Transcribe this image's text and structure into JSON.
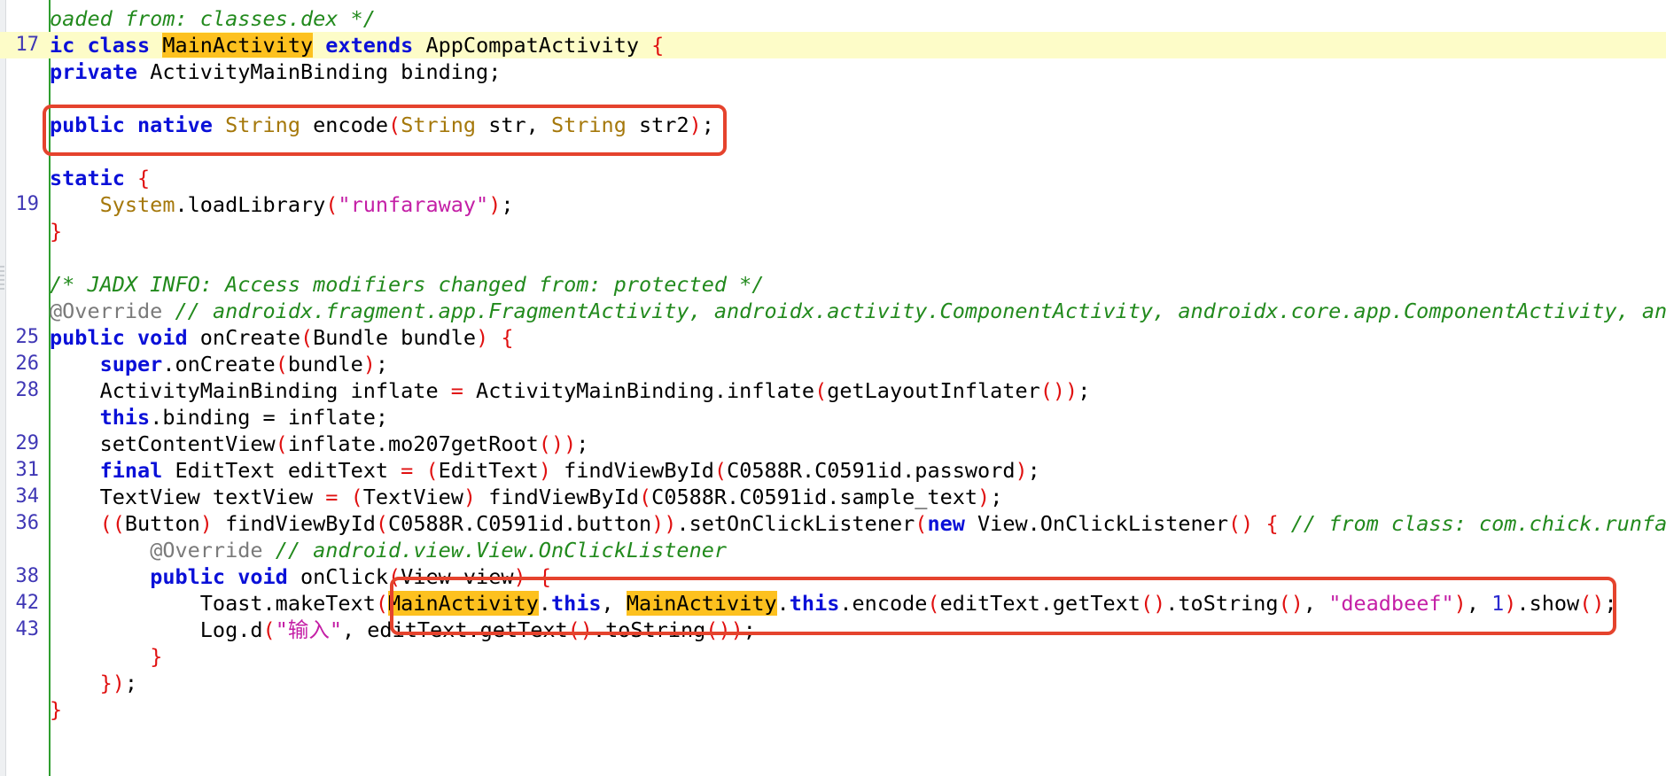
{
  "editor": {
    "lines": [
      {
        "no": "",
        "tokens": [
          [
            "cm",
            "oaded from: classes.dex */"
          ]
        ]
      },
      {
        "no": "17",
        "current": true,
        "tokens": [
          [
            "kw",
            "ic class "
          ],
          [
            "hl",
            "MainActivity"
          ],
          [
            "pl",
            " "
          ],
          [
            "kw",
            "extends"
          ],
          [
            "pl",
            " AppCompatActivity "
          ],
          [
            "pn",
            "{"
          ]
        ]
      },
      {
        "no": "",
        "tokens": [
          [
            "kw",
            "private"
          ],
          [
            "pl",
            " ActivityMainBinding binding;"
          ]
        ]
      },
      {
        "no": "",
        "tokens": []
      },
      {
        "no": "",
        "tokens": [
          [
            "kw",
            "public native"
          ],
          [
            "pl",
            " "
          ],
          [
            "ty",
            "String"
          ],
          [
            "pl",
            " encode"
          ],
          [
            "pn",
            "("
          ],
          [
            "ty",
            "String"
          ],
          [
            "pl",
            " str, "
          ],
          [
            "ty",
            "String"
          ],
          [
            "pl",
            " str2"
          ],
          [
            "pn",
            ")"
          ],
          [
            "pl",
            ";"
          ]
        ]
      },
      {
        "no": "",
        "tokens": []
      },
      {
        "no": "",
        "tokens": [
          [
            "kw",
            "static"
          ],
          [
            "pl",
            " "
          ],
          [
            "pn",
            "{"
          ]
        ]
      },
      {
        "no": "19",
        "tokens": [
          [
            "pl",
            "    "
          ],
          [
            "ty",
            "System"
          ],
          [
            "pl",
            ".loadLibrary"
          ],
          [
            "pn",
            "("
          ],
          [
            "st",
            "\"runfaraway\""
          ],
          [
            "pn",
            ")"
          ],
          [
            "pl",
            ";"
          ]
        ]
      },
      {
        "no": "",
        "tokens": [
          [
            "pn",
            "}"
          ]
        ]
      },
      {
        "no": "",
        "tokens": []
      },
      {
        "no": "",
        "tokens": [
          [
            "cm",
            "/* JADX INFO: Access modifiers changed from: protected */"
          ]
        ]
      },
      {
        "no": "",
        "tokens": [
          [
            "an",
            "@Override"
          ],
          [
            "pl",
            " "
          ],
          [
            "cm",
            "// androidx.fragment.app.FragmentActivity, androidx.activity.ComponentActivity, androidx.core.app.ComponentActivity, andr"
          ]
        ]
      },
      {
        "no": "25",
        "tokens": [
          [
            "kw",
            "public void"
          ],
          [
            "pl",
            " onCreate"
          ],
          [
            "pn",
            "("
          ],
          [
            "pl",
            "Bundle bundle"
          ],
          [
            "pn",
            ")"
          ],
          [
            "pl",
            " "
          ],
          [
            "pn",
            "{"
          ]
        ]
      },
      {
        "no": "26",
        "tokens": [
          [
            "pl",
            "    "
          ],
          [
            "kw",
            "super"
          ],
          [
            "pl",
            ".onCreate"
          ],
          [
            "pn",
            "("
          ],
          [
            "pl",
            "bundle"
          ],
          [
            "pn",
            ")"
          ],
          [
            "pl",
            ";"
          ]
        ]
      },
      {
        "no": "28",
        "tokens": [
          [
            "pl",
            "    ActivityMainBinding inflate "
          ],
          [
            "pn",
            "="
          ],
          [
            "pl",
            " ActivityMainBinding.inflate"
          ],
          [
            "pn",
            "("
          ],
          [
            "pl",
            "getLayoutInflater"
          ],
          [
            "pn",
            "())"
          ],
          [
            "pl",
            ";"
          ]
        ]
      },
      {
        "no": "",
        "tokens": [
          [
            "pl",
            "    "
          ],
          [
            "kw",
            "this"
          ],
          [
            "pl",
            ".binding = inflate;"
          ]
        ]
      },
      {
        "no": "29",
        "tokens": [
          [
            "pl",
            "    setContentView"
          ],
          [
            "pn",
            "("
          ],
          [
            "pl",
            "inflate.mo207getRoot"
          ],
          [
            "pn",
            "())"
          ],
          [
            "pl",
            ";"
          ]
        ]
      },
      {
        "no": "31",
        "tokens": [
          [
            "pl",
            "    "
          ],
          [
            "kw",
            "final"
          ],
          [
            "pl",
            " EditText editText "
          ],
          [
            "pn",
            "="
          ],
          [
            "pl",
            " "
          ],
          [
            "pn",
            "("
          ],
          [
            "pl",
            "EditText"
          ],
          [
            "pn",
            ")"
          ],
          [
            "pl",
            " findViewById"
          ],
          [
            "pn",
            "("
          ],
          [
            "pl",
            "C0588R.C0591id.password"
          ],
          [
            "pn",
            ")"
          ],
          [
            "pl",
            ";"
          ]
        ]
      },
      {
        "no": "34",
        "tokens": [
          [
            "pl",
            "    TextView textView "
          ],
          [
            "pn",
            "="
          ],
          [
            "pl",
            " "
          ],
          [
            "pn",
            "("
          ],
          [
            "pl",
            "TextView"
          ],
          [
            "pn",
            ")"
          ],
          [
            "pl",
            " findViewById"
          ],
          [
            "pn",
            "("
          ],
          [
            "pl",
            "C0588R.C0591id.sample_text"
          ],
          [
            "pn",
            ")"
          ],
          [
            "pl",
            ";"
          ]
        ]
      },
      {
        "no": "36",
        "tokens": [
          [
            "pl",
            "    "
          ],
          [
            "pn",
            "(("
          ],
          [
            "pl",
            "Button"
          ],
          [
            "pn",
            ")"
          ],
          [
            "pl",
            " findViewById"
          ],
          [
            "pn",
            "("
          ],
          [
            "pl",
            "C0588R.C0591id.button"
          ],
          [
            "pn",
            "))"
          ],
          [
            "pl",
            ".setOnClickListener"
          ],
          [
            "pn",
            "("
          ],
          [
            "kw",
            "new"
          ],
          [
            "pl",
            " View.OnClickListener"
          ],
          [
            "pn",
            "()"
          ],
          [
            "pl",
            " "
          ],
          [
            "pn",
            "{"
          ],
          [
            "pl",
            " "
          ],
          [
            "cm",
            "// from class: com.chick.runfara"
          ]
        ]
      },
      {
        "no": "",
        "tokens": [
          [
            "pl",
            "        "
          ],
          [
            "an",
            "@Override"
          ],
          [
            "pl",
            " "
          ],
          [
            "cm",
            "// android.view.View.OnClickListener"
          ]
        ]
      },
      {
        "no": "38",
        "tokens": [
          [
            "pl",
            "        "
          ],
          [
            "kw",
            "public void"
          ],
          [
            "pl",
            " onClick"
          ],
          [
            "pn",
            "("
          ],
          [
            "pl",
            "View view"
          ],
          [
            "pn",
            ")"
          ],
          [
            "pl",
            " "
          ],
          [
            "pn",
            "{"
          ]
        ]
      },
      {
        "no": "42",
        "tokens": [
          [
            "pl",
            "            Toast.makeText"
          ],
          [
            "pn",
            "("
          ],
          [
            "hl",
            "MainActivity"
          ],
          [
            "pl",
            "."
          ],
          [
            "kw",
            "this"
          ],
          [
            "pl",
            ", "
          ],
          [
            "hl",
            "MainActivity"
          ],
          [
            "pl",
            "."
          ],
          [
            "kw",
            "this"
          ],
          [
            "pl",
            ".encode"
          ],
          [
            "pn",
            "("
          ],
          [
            "pl",
            "editText.getText"
          ],
          [
            "pn",
            "()"
          ],
          [
            "pl",
            ".toString"
          ],
          [
            "pn",
            "()"
          ],
          [
            "pl",
            ", "
          ],
          [
            "st",
            "\"deadbeef\""
          ],
          [
            "pn",
            ")"
          ],
          [
            "pl",
            ", "
          ],
          [
            "nm",
            "1"
          ],
          [
            "pn",
            ")"
          ],
          [
            "pl",
            ".show"
          ],
          [
            "pn",
            "()"
          ],
          [
            "pl",
            ";"
          ]
        ]
      },
      {
        "no": "43",
        "tokens": [
          [
            "pl",
            "            Log.d"
          ],
          [
            "pn",
            "("
          ],
          [
            "st",
            "\"输入\""
          ],
          [
            "pl",
            ", editText.getText"
          ],
          [
            "pn",
            "()"
          ],
          [
            "pl",
            ".toString"
          ],
          [
            "pn",
            "())"
          ],
          [
            "pl",
            ";"
          ]
        ]
      },
      {
        "no": "",
        "tokens": [
          [
            "pl",
            "        "
          ],
          [
            "pn",
            "}"
          ]
        ]
      },
      {
        "no": "",
        "tokens": [
          [
            "pl",
            "    "
          ],
          [
            "pn",
            "})"
          ],
          [
            "pl",
            ";"
          ]
        ]
      },
      {
        "no": "",
        "tokens": [
          [
            "pn",
            "}"
          ]
        ]
      }
    ]
  },
  "colors": {
    "keyword": "#0a10d8",
    "type": "#a5780b",
    "string": "#c41fa6",
    "comment": "#228a1d",
    "annotation": "#7a7a7a",
    "punctuation": "#e01010",
    "highlight": "#fdc11f",
    "current_line": "#fdfcc8",
    "callout": "#e5432d",
    "gutter": "#2f9d2f"
  }
}
